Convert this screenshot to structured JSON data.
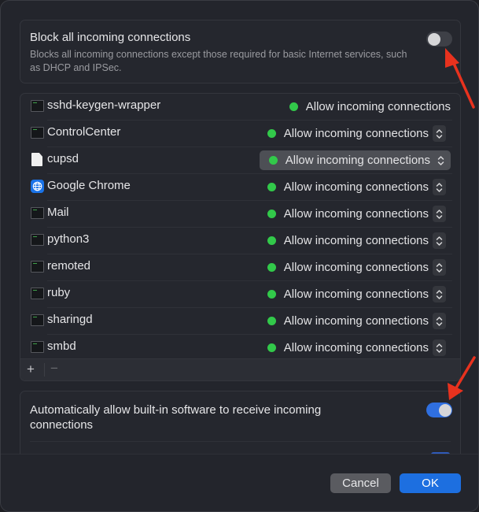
{
  "block_section": {
    "title": "Block all incoming connections",
    "description": "Blocks all incoming connections except those required for basic Internet services, such as DHCP and IPSec.",
    "toggle_on": false
  },
  "apps": [
    {
      "name": "sshd-keygen-wrapper",
      "icon": "terminal-icon",
      "status": "Allow incoming connections",
      "has_stepper": false,
      "selected": false
    },
    {
      "name": "ControlCenter",
      "icon": "terminal-icon",
      "status": "Allow incoming connections",
      "has_stepper": true,
      "selected": false
    },
    {
      "name": "cupsd",
      "icon": "file-icon",
      "status": "Allow incoming connections",
      "has_stepper": true,
      "selected": true
    },
    {
      "name": "Google Chrome",
      "icon": "globe-icon",
      "status": "Allow incoming connections",
      "has_stepper": true,
      "selected": false
    },
    {
      "name": "Mail",
      "icon": "terminal-icon",
      "status": "Allow incoming connections",
      "has_stepper": true,
      "selected": false
    },
    {
      "name": "python3",
      "icon": "terminal-icon",
      "status": "Allow incoming connections",
      "has_stepper": true,
      "selected": false
    },
    {
      "name": "remoted",
      "icon": "terminal-icon",
      "status": "Allow incoming connections",
      "has_stepper": true,
      "selected": false
    },
    {
      "name": "ruby",
      "icon": "terminal-icon",
      "status": "Allow incoming connections",
      "has_stepper": true,
      "selected": false
    },
    {
      "name": "sharingd",
      "icon": "terminal-icon",
      "status": "Allow incoming connections",
      "has_stepper": true,
      "selected": false
    },
    {
      "name": "smbd",
      "icon": "terminal-icon",
      "status": "Allow incoming connections",
      "has_stepper": true,
      "selected": false
    }
  ],
  "list_footer": {
    "add_label": "+",
    "remove_label": "−"
  },
  "auto_section": {
    "title": "Automatically allow built-in software to receive incoming connections",
    "toggle_on": true
  },
  "buttons": {
    "cancel": "Cancel",
    "ok": "OK"
  },
  "colors": {
    "accent": "#1d6fe0",
    "status_green": "#32c94a",
    "annotation_red": "#e8321e"
  }
}
